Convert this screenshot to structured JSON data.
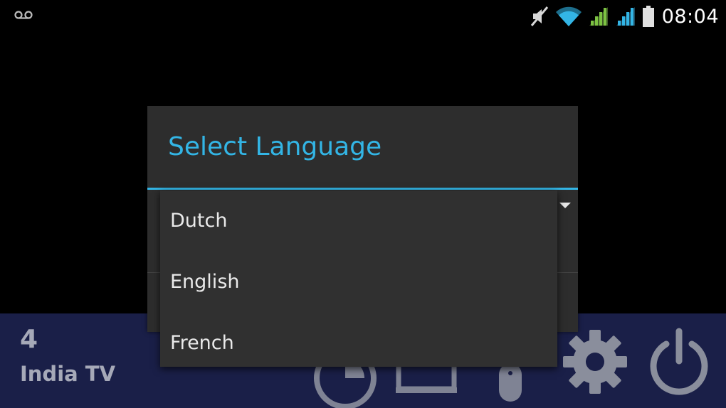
{
  "status_bar": {
    "time": "08:04",
    "icons": [
      "voicemail-icon",
      "muted-speaker-icon",
      "wifi-icon",
      "signal-icon",
      "signal-icon",
      "battery-icon"
    ]
  },
  "dialog": {
    "title": "Select Language",
    "spinner_icon": "dropdown-arrow-icon"
  },
  "dropdown": {
    "options": [
      "Dutch",
      "English",
      "French"
    ]
  },
  "bottom_bar": {
    "channel_number": "4",
    "channel_name": "India TV",
    "icons": [
      "pie-chart-icon",
      "tv-icon",
      "remote-icon",
      "gear-icon",
      "power-icon"
    ]
  },
  "colors": {
    "accent": "#33b5e5",
    "dialog_bg": "#2d2d2d",
    "bottom_bar_bg": "#1a1f48",
    "signal_green": "#7cc242",
    "signal_blue": "#33b5e5"
  }
}
